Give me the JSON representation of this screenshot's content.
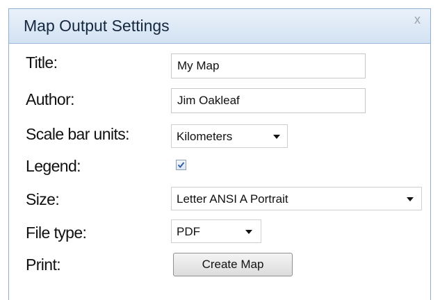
{
  "dialog": {
    "title": "Map Output Settings",
    "close_glyph": "x"
  },
  "fields": {
    "title": {
      "label": "Title:",
      "value": "My Map"
    },
    "author": {
      "label": "Author:",
      "value": "Jim Oakleaf"
    },
    "scale_bar_units": {
      "label": "Scale bar units:",
      "selected": "Kilometers"
    },
    "legend": {
      "label": "Legend:",
      "checked": true
    },
    "size": {
      "label": "Size:",
      "selected": "Letter ANSI A Portrait"
    },
    "file_type": {
      "label": "File type:",
      "selected": "PDF"
    },
    "print": {
      "label": "Print:",
      "button_label": "Create Map"
    }
  },
  "icons": {
    "close": "close-icon",
    "dropdown": "chevron-down-icon",
    "check": "checkmark-icon"
  },
  "colors": {
    "titlebar": "#d3e2f2",
    "border": "#8fb0d2",
    "check": "#2f5fa8"
  }
}
